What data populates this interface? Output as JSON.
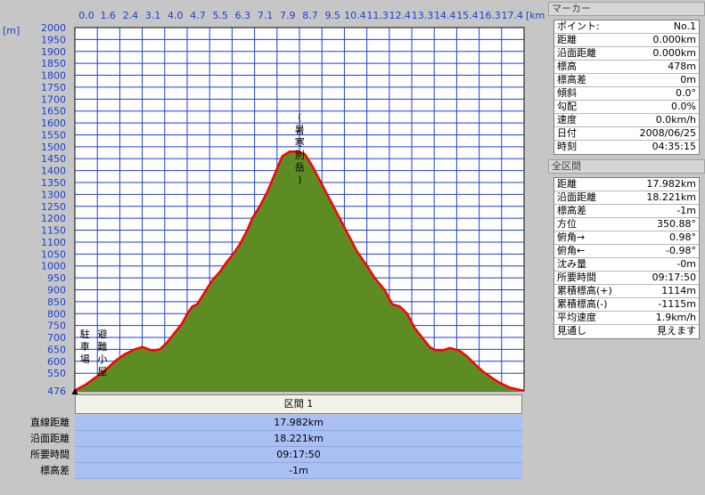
{
  "chart_data": {
    "type": "area",
    "x_unit": "[km]",
    "y_unit": "[m]",
    "x_ticks": [
      "0.0",
      "1.6",
      "2.4",
      "3.1",
      "4.0",
      "4.7",
      "5.5",
      "6.3",
      "7.1",
      "7.9",
      "8.7",
      "9.5",
      "10.4",
      "11.3",
      "12.4",
      "13.3",
      "14.4",
      "15.4",
      "16.3",
      "17.4"
    ],
    "y_ticks": [
      2000,
      1950,
      1900,
      1850,
      1800,
      1750,
      1700,
      1650,
      1600,
      1550,
      1500,
      1450,
      1400,
      1350,
      1300,
      1250,
      1200,
      1150,
      1100,
      1050,
      1000,
      950,
      900,
      850,
      800,
      750,
      700,
      650,
      600,
      550,
      476
    ],
    "ylim": [
      476,
      2000
    ],
    "xlim": [
      0,
      17.982
    ],
    "profile": [
      [
        0.0,
        478
      ],
      [
        0.4,
        500
      ],
      [
        0.8,
        530
      ],
      [
        1.2,
        560
      ],
      [
        1.6,
        600
      ],
      [
        2.0,
        630
      ],
      [
        2.4,
        650
      ],
      [
        2.7,
        660
      ],
      [
        3.1,
        645
      ],
      [
        3.4,
        650
      ],
      [
        3.7,
        680
      ],
      [
        4.0,
        720
      ],
      [
        4.3,
        760
      ],
      [
        4.5,
        800
      ],
      [
        4.7,
        830
      ],
      [
        4.9,
        840
      ],
      [
        5.2,
        890
      ],
      [
        5.5,
        940
      ],
      [
        5.8,
        975
      ],
      [
        6.1,
        1020
      ],
      [
        6.3,
        1045
      ],
      [
        6.6,
        1090
      ],
      [
        6.9,
        1150
      ],
      [
        7.1,
        1200
      ],
      [
        7.4,
        1250
      ],
      [
        7.7,
        1310
      ],
      [
        7.9,
        1360
      ],
      [
        8.1,
        1410
      ],
      [
        8.3,
        1460
      ],
      [
        8.6,
        1480
      ],
      [
        8.9,
        1480
      ],
      [
        9.2,
        1470
      ],
      [
        9.5,
        1420
      ],
      [
        9.8,
        1360
      ],
      [
        10.1,
        1300
      ],
      [
        10.4,
        1240
      ],
      [
        10.7,
        1180
      ],
      [
        11.0,
        1120
      ],
      [
        11.3,
        1060
      ],
      [
        11.7,
        1000
      ],
      [
        12.0,
        950
      ],
      [
        12.4,
        900
      ],
      [
        12.7,
        840
      ],
      [
        13.0,
        830
      ],
      [
        13.3,
        800
      ],
      [
        13.6,
        740
      ],
      [
        13.9,
        700
      ],
      [
        14.2,
        660
      ],
      [
        14.4,
        648
      ],
      [
        14.7,
        645
      ],
      [
        15.0,
        656
      ],
      [
        15.4,
        645
      ],
      [
        15.7,
        620
      ],
      [
        16.0,
        590
      ],
      [
        16.3,
        560
      ],
      [
        16.7,
        530
      ],
      [
        17.0,
        510
      ],
      [
        17.4,
        490
      ],
      [
        17.982,
        476
      ]
    ],
    "annotations": [
      {
        "text": "駐車場",
        "x": 0.4,
        "y": 700
      },
      {
        "text": "避難小屋",
        "x": 1.1,
        "y": 700
      },
      {
        "text": "(暑寒別岳)",
        "x": 9.0,
        "y": 1610
      }
    ],
    "fill_color": "#5d8c25",
    "line_color": "#ff0000",
    "grid_color": "#1f3fd0",
    "background": "#ffffff"
  },
  "section": {
    "label": "区間 1",
    "rows": [
      {
        "label": "直線距離",
        "value": "17.982km"
      },
      {
        "label": "沿面距離",
        "value": "18.221km"
      },
      {
        "label": "所要時間",
        "value": "09:17:50"
      },
      {
        "label": "標高差",
        "value": "-1m"
      }
    ]
  },
  "marker": {
    "title": "マーカー",
    "rows": [
      {
        "label": "ポイント:",
        "value": "No.1"
      },
      {
        "label": "距離",
        "value": "0.000km"
      },
      {
        "label": "沿面距離",
        "value": "0.000km"
      },
      {
        "label": "標高",
        "value": "478m"
      },
      {
        "label": "標高差",
        "value": "0m"
      },
      {
        "label": "傾斜",
        "value": "0.0°"
      },
      {
        "label": "勾配",
        "value": "0.0%"
      },
      {
        "label": "速度",
        "value": "0.0km/h"
      },
      {
        "label": "日付",
        "value": "2008/06/25"
      },
      {
        "label": "時刻",
        "value": "04:35:15"
      }
    ]
  },
  "all_sections": {
    "title": "全区間",
    "rows": [
      {
        "label": "距離",
        "value": "17.982km"
      },
      {
        "label": "沿面距離",
        "value": "18.221km"
      },
      {
        "label": "標高差",
        "value": "-1m"
      },
      {
        "label": "方位",
        "value": "350.88°"
      },
      {
        "label": "俯角→",
        "value": "0.98°"
      },
      {
        "label": "俯角←",
        "value": "-0.98°"
      },
      {
        "label": "沈み量",
        "value": "-0m"
      },
      {
        "label": "所要時間",
        "value": "09:17:50"
      },
      {
        "label": "累積標高(+)",
        "value": "1114m"
      },
      {
        "label": "累積標高(-)",
        "value": "-1115m"
      },
      {
        "label": "平均速度",
        "value": "1.9km/h"
      },
      {
        "label": "見通し",
        "value": "見えます"
      }
    ]
  }
}
